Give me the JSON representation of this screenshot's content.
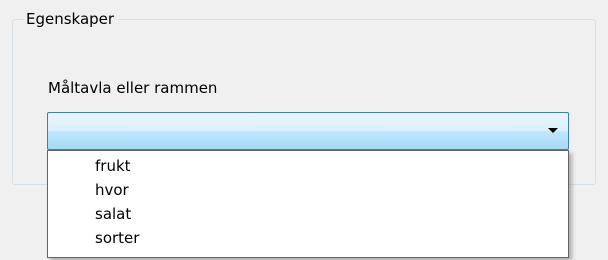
{
  "groupbox": {
    "title": "Egenskaper"
  },
  "field": {
    "label": "Måltavla eller rammen",
    "selected_value": "",
    "options": [
      "frukt",
      "hvor",
      "salat",
      "sorter"
    ]
  },
  "icons": {
    "dropdown_arrow": "chevron-down-icon"
  },
  "colors": {
    "window_background": "#f0f0f0",
    "combo_border": "#3c7fb1",
    "combo_fill_top": "#eaf6fd",
    "combo_fill_bottom": "#a7d9f5",
    "list_background": "#ffffff"
  }
}
